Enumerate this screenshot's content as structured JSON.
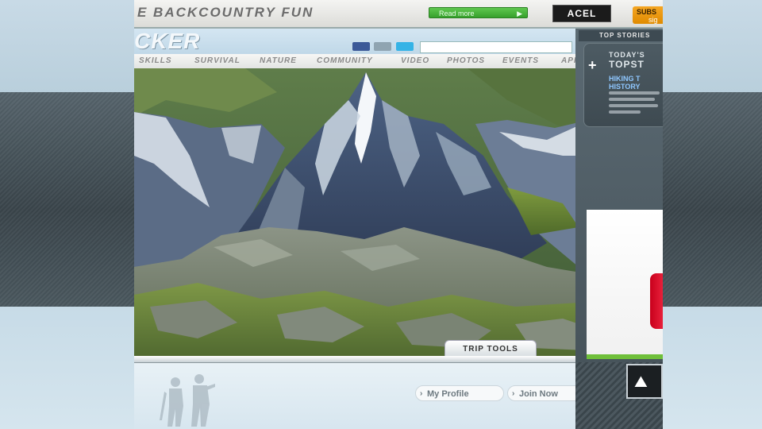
{
  "site": {
    "tagline": "E BACKCOUNTRY FUN",
    "promo_button": "Read more",
    "dark_button": "ACEL",
    "orange_tab": {
      "line1": "SUBS",
      "line2": "sig"
    },
    "logo": "CKER"
  },
  "nav": {
    "items": [
      "SKILLS",
      "SURVIVAL",
      "NATURE",
      "COMMUNITY",
      "VIDEO",
      "PHOTOS",
      "EVENTS",
      "APP"
    ]
  },
  "hero": {
    "tab_label": "TRIP TOOLS"
  },
  "footer": {
    "my_profile": "My Profile",
    "join_now": "Join Now"
  },
  "sidebar": {
    "tab": "TOP STORIES",
    "today": "TODAY'S",
    "topstories": "TOPST",
    "headline_1": "HIKING T",
    "headline_2": "HISTORY"
  },
  "colors": {
    "green_button": "#3fb132",
    "orange_tab": "#f5a623",
    "facebook": "#3b5998",
    "twitter": "#35b3e6",
    "sidebar": "#4f5d65"
  }
}
